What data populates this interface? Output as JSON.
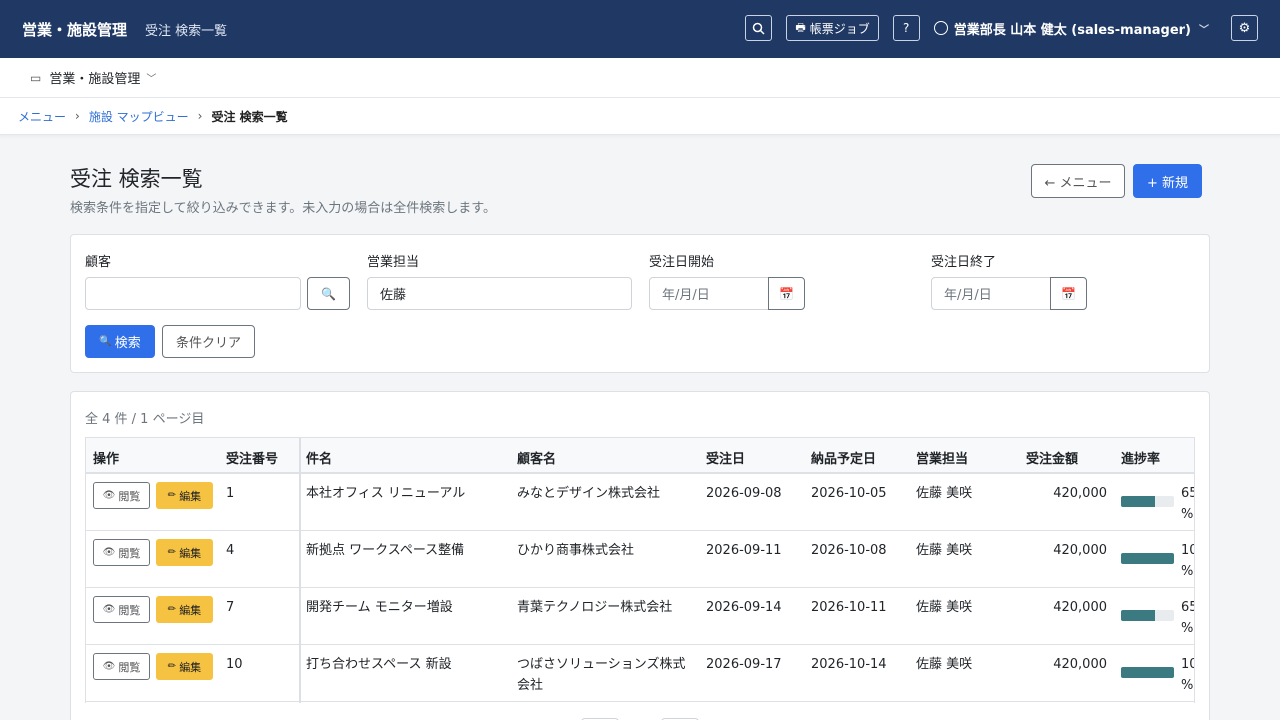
{
  "app": {
    "brand": "営業・施設管理",
    "page_subtitle": "受注 検索一覧"
  },
  "topbar": {
    "report_job_label": "帳票ジョブ",
    "help_label": "?",
    "user_label": "営業部長 山本 健太 (sales-manager)"
  },
  "subnav": {
    "module_label": "営業・施設管理"
  },
  "breadcrumb": [
    "メニュー",
    "施設 マップビュー",
    "受注 検索一覧"
  ],
  "header": {
    "title": "受注 検索一覧",
    "description": "検索条件を指定して絞り込みできます。未入力の場合は全件検索します。",
    "menu_button": "← メニュー",
    "new_button": "+ 新規"
  },
  "search": {
    "customer_label": "顧客",
    "customer_value": "",
    "sales_rep_label": "営業担当",
    "sales_rep_value": "佐藤",
    "date_from_label": "受注日開始",
    "date_from_placeholder": "年/月/日",
    "date_to_label": "受注日終了",
    "date_to_placeholder": "年/月/日",
    "search_button": "検索",
    "clear_button": "条件クリア"
  },
  "results": {
    "count_text": "全 4 件 / 1 ページ目",
    "columns": [
      "操作",
      "受注番号",
      "件名",
      "顧客名",
      "受注日",
      "納品予定日",
      "営業担当",
      "受注金額",
      "進捗率"
    ],
    "view_label": "閲覧",
    "edit_label": "編集",
    "rows": [
      {
        "no": "1",
        "subject": "本社オフィス リニューアル",
        "customer": "みなとデザイン株式会社",
        "order_date": "2026-09-08",
        "delivery_date": "2026-10-05",
        "rep": "佐藤 美咲",
        "amount": "420,000",
        "progress": 65,
        "progress_text": "65 %"
      },
      {
        "no": "4",
        "subject": "新拠点 ワークスペース整備",
        "customer": "ひかり商事株式会社",
        "order_date": "2026-09-11",
        "delivery_date": "2026-10-08",
        "rep": "佐藤 美咲",
        "amount": "420,000",
        "progress": 100,
        "progress_text": "10 %"
      },
      {
        "no": "7",
        "subject": "開発チーム モニター増設",
        "customer": "青葉テクノロジー株式会社",
        "order_date": "2026-09-14",
        "delivery_date": "2026-10-11",
        "rep": "佐藤 美咲",
        "amount": "420,000",
        "progress": 65,
        "progress_text": "65 %"
      },
      {
        "no": "10",
        "subject": "打ち合わせスペース 新設",
        "customer": "つばさソリューションズ株式会社",
        "order_date": "2026-09-17",
        "delivery_date": "2026-10-14",
        "rep": "佐藤 美咲",
        "amount": "420,000",
        "progress": 100,
        "progress_text": "10 %"
      }
    ]
  },
  "colors": {
    "topbar": "#1f3864",
    "primary": "#2f6fea",
    "edit": "#f5c242",
    "progress": "#3a7a80",
    "link": "#2f6fd6"
  }
}
